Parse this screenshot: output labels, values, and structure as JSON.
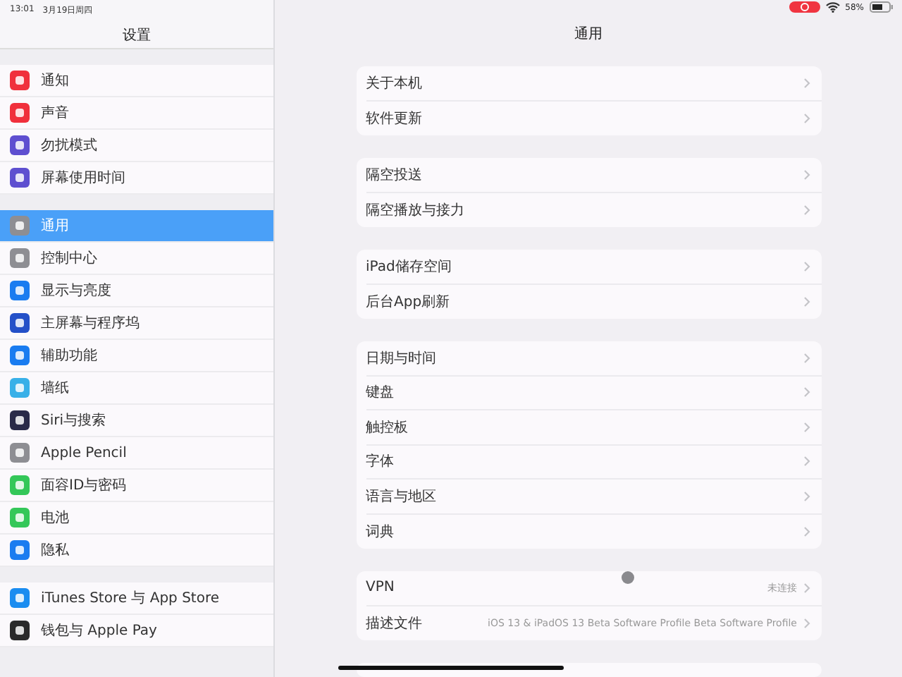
{
  "status_bar": {
    "time": "13:01",
    "date": "3月19日周四",
    "battery": "58%"
  },
  "sidebar": {
    "title": "设置",
    "groups": [
      [
        {
          "label": "通知",
          "color": "#f0303c",
          "selected": false
        },
        {
          "label": "声音",
          "color": "#f0303c",
          "selected": false
        },
        {
          "label": "勿扰模式",
          "color": "#5e4fd0",
          "selected": false
        },
        {
          "label": "屏幕使用时间",
          "color": "#5e4fd0",
          "selected": false
        }
      ],
      [
        {
          "label": "通用",
          "color": "#8e8e93",
          "selected": true
        },
        {
          "label": "控制中心",
          "color": "#8e8e93",
          "selected": false
        },
        {
          "label": "显示与亮度",
          "color": "#1a7cf0",
          "selected": false
        },
        {
          "label": "主屏幕与程序坞",
          "color": "#2450c8",
          "selected": false
        },
        {
          "label": "辅助功能",
          "color": "#1a7cf0",
          "selected": false
        },
        {
          "label": "墙纸",
          "color": "#38b0e8",
          "selected": false
        },
        {
          "label": "Siri与搜索",
          "color": "#2a2a48",
          "selected": false
        },
        {
          "label": "Apple Pencil",
          "color": "#8e8e93",
          "selected": false
        },
        {
          "label": "面容ID与密码",
          "color": "#34c759",
          "selected": false
        },
        {
          "label": "电池",
          "color": "#34c759",
          "selected": false
        },
        {
          "label": "隐私",
          "color": "#1a7cf0",
          "selected": false
        }
      ],
      [
        {
          "label": "iTunes Store 与 App Store",
          "color": "#1a8cf0",
          "selected": false
        },
        {
          "label": "钱包与 Apple Pay",
          "color": "#2a2a2a",
          "selected": false
        }
      ]
    ]
  },
  "main": {
    "title": "通用",
    "groups": [
      [
        {
          "label": "关于本机"
        },
        {
          "label": "软件更新"
        }
      ],
      [
        {
          "label": "隔空投送"
        },
        {
          "label": "隔空播放与接力"
        }
      ],
      [
        {
          "label": "iPad储存空间"
        },
        {
          "label": "后台App刷新"
        }
      ],
      [
        {
          "label": "日期与时间"
        },
        {
          "label": "键盘"
        },
        {
          "label": "触控板"
        },
        {
          "label": "字体"
        },
        {
          "label": "语言与地区"
        },
        {
          "label": "词典"
        }
      ],
      [
        {
          "label": "VPN",
          "value": "未连接"
        },
        {
          "label": "描述文件",
          "value": "iOS 13 & iPadOS 13 Beta Software Profile Beta Software Profile"
        }
      ]
    ]
  }
}
